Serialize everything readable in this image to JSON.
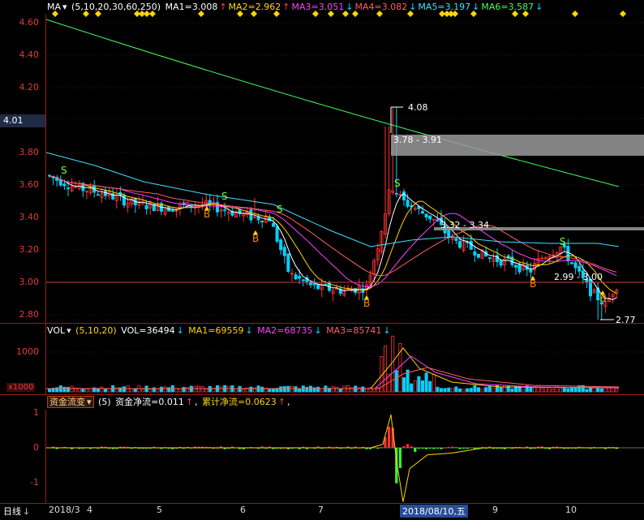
{
  "main_header": {
    "name": "MA",
    "params": "(5,10,20,30,60,250)",
    "ma_items": [
      {
        "label": "MA1=3.008",
        "arrow": "↑",
        "color": "#ffffff",
        "arrowColor": "#ff4040"
      },
      {
        "label": "MA2=2.962",
        "arrow": "↑",
        "color": "#ffd700",
        "arrowColor": "#ff4040"
      },
      {
        "label": "MA3=3.051",
        "arrow": "↓",
        "color": "#ff40ff",
        "arrowColor": "#00e0ff"
      },
      {
        "label": "MA4=3.082",
        "arrow": "↓",
        "color": "#ff6060",
        "arrowColor": "#00e0ff"
      },
      {
        "label": "MA5=3.197",
        "arrow": "↓",
        "color": "#40e0ff",
        "arrowColor": "#00e0ff"
      },
      {
        "label": "MA6=3.587",
        "arrow": "↓",
        "color": "#40ff60",
        "arrowColor": "#00e0ff"
      }
    ]
  },
  "price_axis": {
    "ticks": [
      "4.60",
      "4.40",
      "4.20",
      "4.01",
      "3.80",
      "3.60",
      "3.40",
      "3.20",
      "3.00",
      "2.80"
    ],
    "current": "4.01"
  },
  "annotations": {
    "high": "4.08",
    "zone1": "3.78 - 3.91",
    "zone2": "3.32 - 3.34",
    "zone3": "2.99 - 3.00",
    "low": "2.77",
    "signal_S": "S",
    "signal_B": "B"
  },
  "vol_header": {
    "name": "VOL",
    "params": "(5,10,20)",
    "vol": "VOL=36494",
    "vol_arrow": "↓",
    "ma1": "MA1=69559",
    "ma1_arrow": "↓",
    "ma2": "MA2=68735",
    "ma2_arrow": "↓",
    "ma3": "MA3=85741",
    "ma3_arrow": "↓",
    "tick": "1000",
    "unit": "x1000"
  },
  "flow_header": {
    "name": "资金流变",
    "params": "(5)",
    "net": "资金净流=0.011",
    "net_arrow": "↑",
    "cum": "累计净流=0.0623",
    "cum_arrow": "↑",
    "tail": ",",
    "ticks": [
      "1",
      "0",
      "-1"
    ]
  },
  "dates": {
    "corner": "日线",
    "labels": [
      "2018/3",
      "4",
      "5",
      "6",
      "7",
      "2018/08/10,五",
      "9",
      "10"
    ]
  },
  "colors": {
    "up": "#ff3232",
    "down": "#00d2ff",
    "ma5": "#ffffff",
    "ma10": "#ffd700",
    "ma20": "#ff40ff",
    "ma30": "#ff6060",
    "ma60": "#40e0ff",
    "ma250": "#40ff60",
    "axis": "#9b1a1a"
  },
  "chart_data": {
    "type": "candlestick",
    "ylim": [
      2.75,
      4.65
    ],
    "ma250": {
      "start": 4.62,
      "end": 3.59
    },
    "key_points": [
      {
        "label": "2018/3",
        "close": 3.68
      },
      {
        "label": "4",
        "close": 3.55
      },
      {
        "label": "5",
        "close": 3.48
      },
      {
        "label": "6",
        "close": 3.42
      },
      {
        "label": "7",
        "close": 2.96
      },
      {
        "label": "2018/08/10",
        "close": 3.55
      },
      {
        "label": "9",
        "close": 3.15
      },
      {
        "label": "10",
        "close": 3.01
      }
    ],
    "levels": {
      "high": 4.08,
      "low": 2.77
    }
  }
}
